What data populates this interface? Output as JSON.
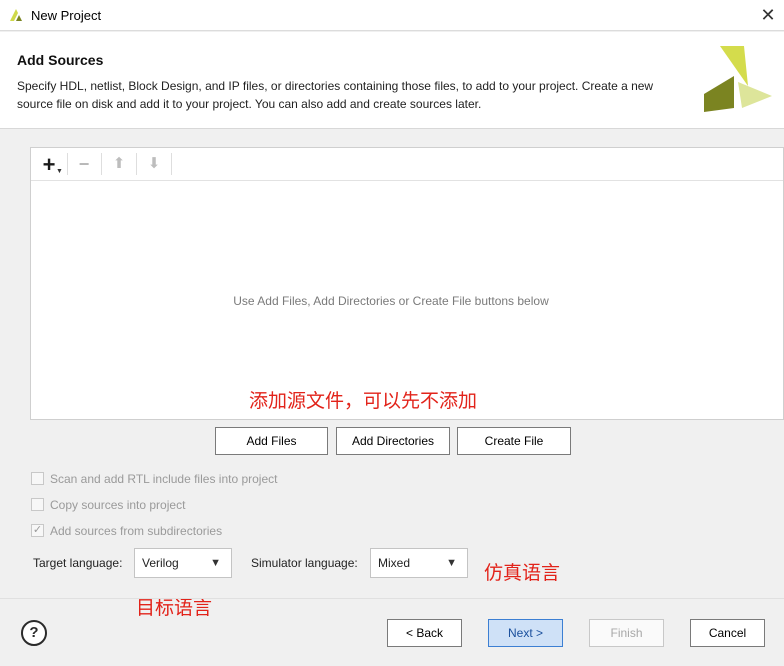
{
  "window": {
    "title": "New Project",
    "close_glyph": "✕"
  },
  "header": {
    "title": "Add Sources",
    "description": "Specify HDL, netlist, Block Design, and IP files, or directories containing those files, to add to your project. Create a new source file on disk and add it to your project. You can also add and create sources later."
  },
  "toolbar": {
    "add_glyph": "+",
    "remove_glyph": "−",
    "up_glyph": "⬆",
    "down_glyph": "⬇"
  },
  "sources": {
    "empty_message": "Use Add Files, Add Directories or Create File buttons below"
  },
  "annotations": {
    "sources_note": "添加源文件，可以先不添加",
    "simulator_note": "仿真语言",
    "target_note": "目标语言"
  },
  "buttons": {
    "add_files": "Add Files",
    "add_directories": "Add Directories",
    "create_file": "Create File",
    "back": "< Back",
    "next": "Next >",
    "finish": "Finish",
    "cancel": "Cancel",
    "help": "?"
  },
  "options": {
    "scan_rtl": {
      "label": "Scan and add RTL include files into project",
      "checked": false
    },
    "copy_sources": {
      "label": "Copy sources into project",
      "checked": false
    },
    "add_subdirs": {
      "label": "Add sources from subdirectories",
      "checked": true
    }
  },
  "languages": {
    "target_label": "Target language:",
    "target_value": "Verilog",
    "simulator_label": "Simulator language:",
    "simulator_value": "Mixed"
  },
  "colors": {
    "logo_light": "#cfd94a",
    "logo_dark": "#7a8420",
    "annotation_red": "#e2231a",
    "next_border": "#3c7fd3"
  }
}
